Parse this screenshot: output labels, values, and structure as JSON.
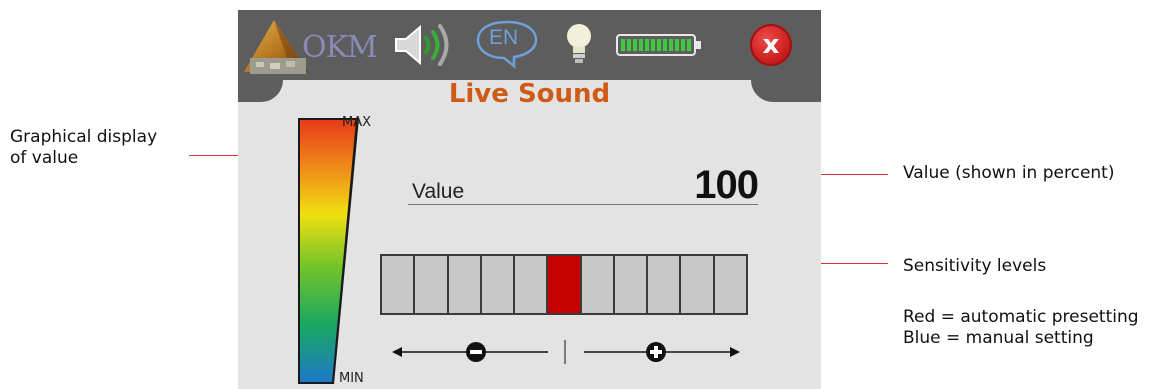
{
  "callouts": {
    "graphical_display": [
      "Graphical display",
      "of value"
    ],
    "value_percent": "Value (shown in percent)",
    "sensitivity": "Sensitivity levels",
    "legend_red": "Red = automatic presetting",
    "legend_blue": "Blue = manual setting"
  },
  "device": {
    "logo_text": "OKM",
    "language": "EN",
    "battery_level": 1.0,
    "close_label": "x",
    "title": "Live Sound",
    "meter": {
      "max_label": "MAX",
      "min_label": "MIN"
    },
    "value_label": "Value",
    "value": "100",
    "sensitivity_levels": {
      "count": 11,
      "active_index": 5
    }
  },
  "colors": {
    "title": "#cf5a16",
    "active_level": "#c40000",
    "leader_line": "#e0303a",
    "topbar": "#5d5d5d"
  },
  "icons": [
    "speaker-icon",
    "language-bubble-icon",
    "light-bulb-icon",
    "battery-icon",
    "minus-icon",
    "plus-icon"
  ]
}
